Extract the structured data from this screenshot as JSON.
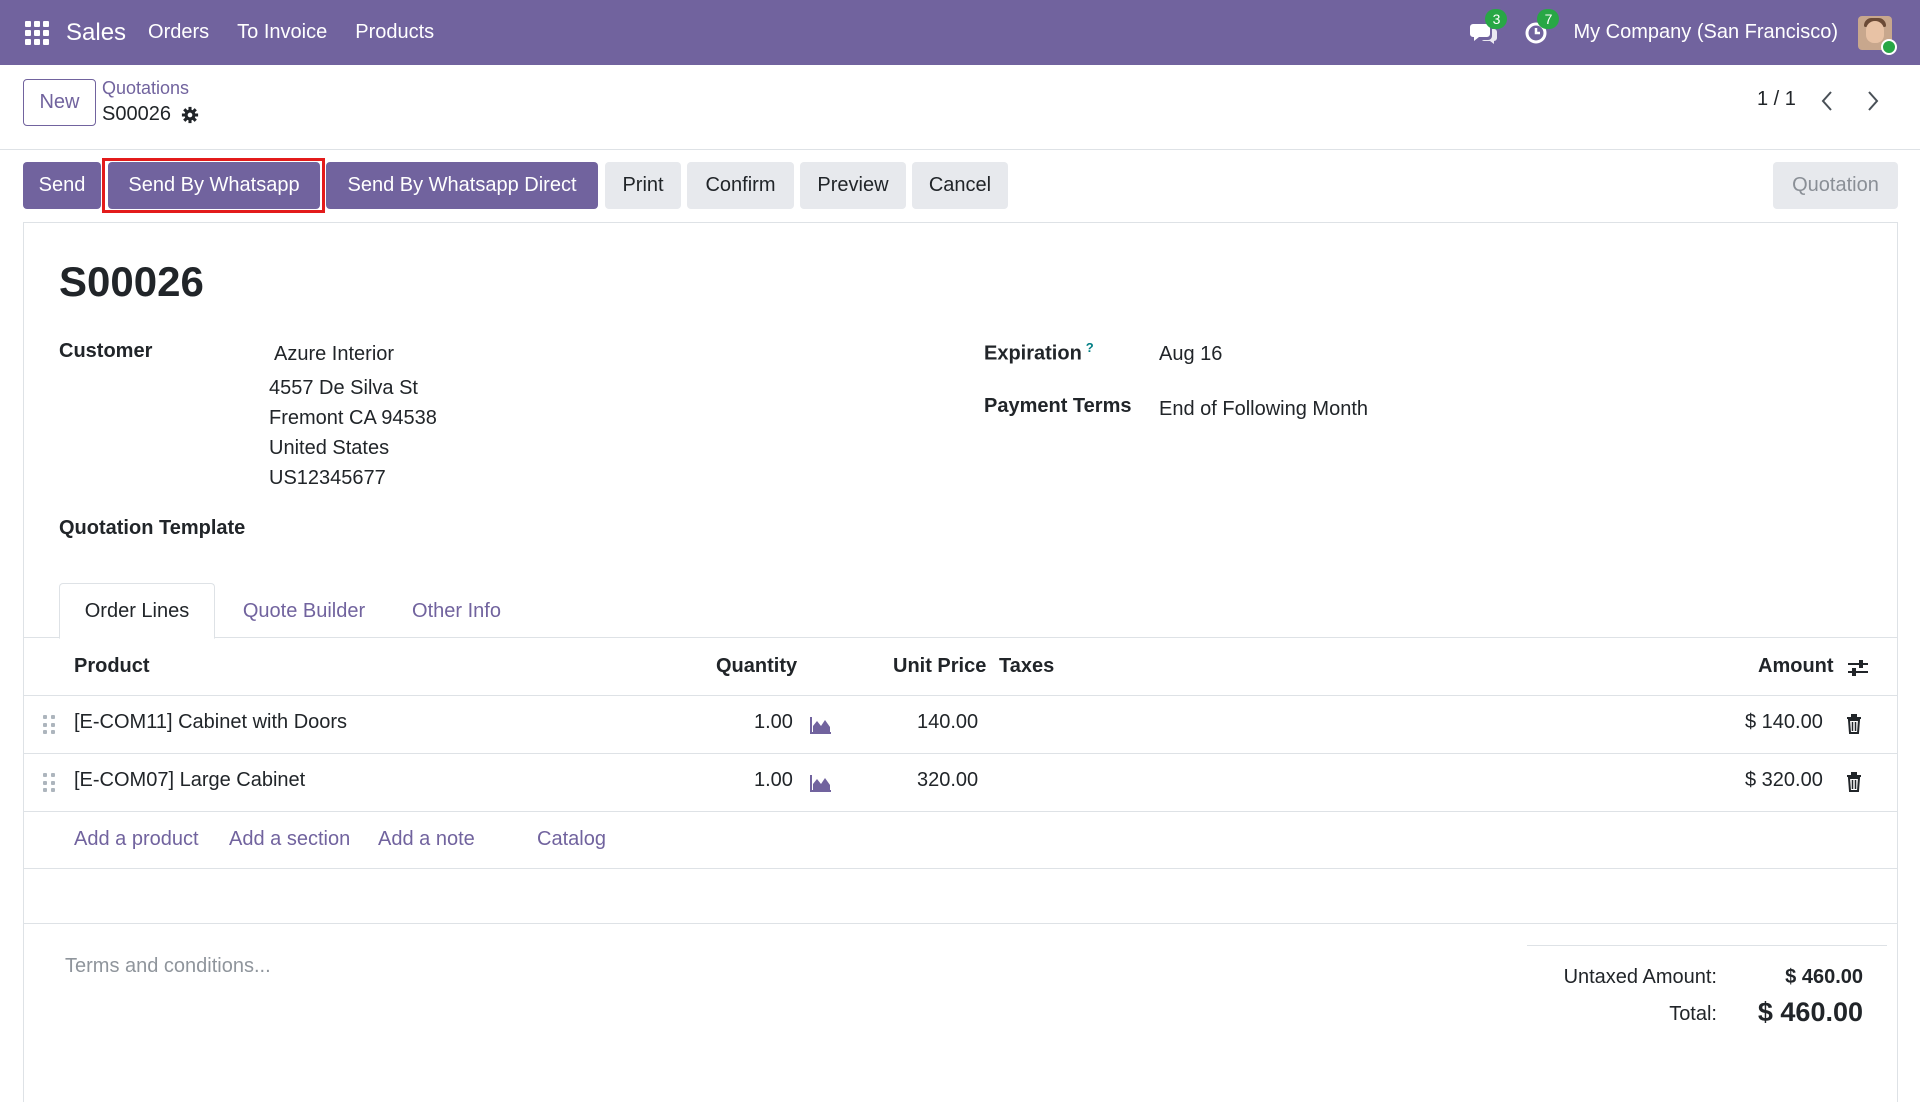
{
  "navbar": {
    "app_name": "Sales",
    "menus": [
      "Orders",
      "To Invoice",
      "Products"
    ],
    "messages_count": "3",
    "activities_count": "7",
    "company": "My Company (San Francisco)"
  },
  "control_panel": {
    "new_label": "New",
    "breadcrumb": "Quotations",
    "record_name": "S00026",
    "pager": "1 / 1"
  },
  "actions": {
    "send": "Send",
    "send_whatsapp": "Send By Whatsapp",
    "send_whatsapp_direct": "Send By Whatsapp Direct",
    "print": "Print",
    "confirm": "Confirm",
    "preview": "Preview",
    "cancel": "Cancel",
    "status": "Quotation"
  },
  "form": {
    "title": "S00026",
    "customer_label": "Customer",
    "customer_name": "Azure Interior",
    "address_lines": [
      "4557 De Silva St",
      "Fremont CA 94538",
      "United States",
      "US12345677"
    ],
    "template_label": "Quotation Template",
    "expiration_label": "Expiration",
    "expiration_help": "?",
    "expiration_value": "Aug 16",
    "payment_terms_label": "Payment Terms",
    "payment_terms_value": "End of Following Month"
  },
  "tabs": [
    "Order Lines",
    "Quote Builder",
    "Other Info"
  ],
  "table": {
    "headers": {
      "product": "Product",
      "quantity": "Quantity",
      "unit_price": "Unit Price",
      "taxes": "Taxes",
      "amount": "Amount"
    },
    "rows": [
      {
        "product": "[E-COM11] Cabinet with Doors",
        "quantity": "1.00",
        "unit_price": "140.00",
        "amount": "$ 140.00"
      },
      {
        "product": "[E-COM07] Large Cabinet",
        "quantity": "1.00",
        "unit_price": "320.00",
        "amount": "$ 320.00"
      }
    ],
    "add_links": [
      "Add a product",
      "Add a section",
      "Add a note",
      "Catalog"
    ]
  },
  "footer": {
    "terms_placeholder": "Terms and conditions...",
    "untaxed_label": "Untaxed Amount:",
    "untaxed_value": "$ 460.00",
    "total_label": "Total:",
    "total_value": "$ 460.00"
  },
  "colors": {
    "brand": "#71639e",
    "badge": "#28a745",
    "highlight": "#e31b1b"
  }
}
